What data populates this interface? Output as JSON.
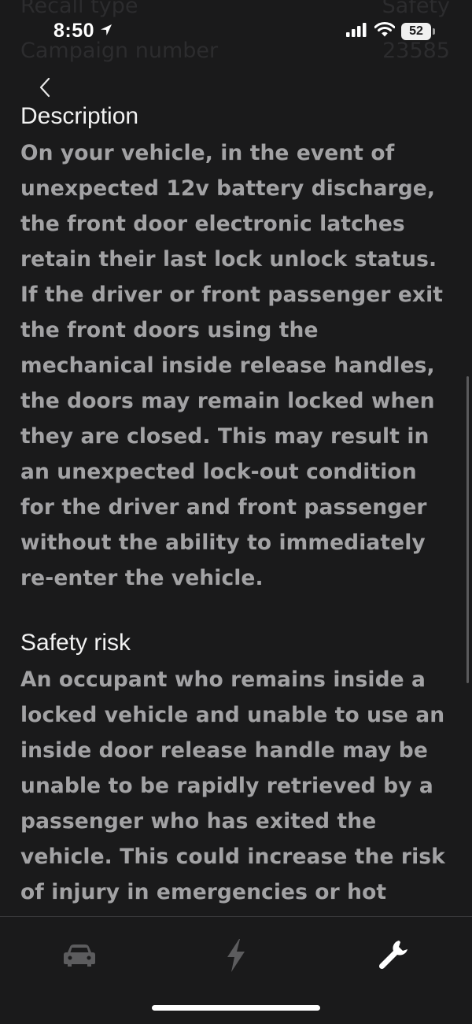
{
  "background_partial": {
    "row1": {
      "label": "Recall type",
      "value": "Safety"
    },
    "row2": {
      "label": "Campaign number",
      "value": "23585"
    }
  },
  "status_bar": {
    "time": "8:50",
    "battery": "52"
  },
  "sections": [
    {
      "title": "Description",
      "body": "On your vehicle, in the event of unexpected 12v battery discharge, the front door electronic latches retain their last lock unlock status. If the driver or front passenger exit the front doors using the mechanical inside release handles, the doors may remain locked when they are closed. This may result in an unexpected lock-out condition for the driver and front passenger without the ability to immediately re-enter the vehicle."
    },
    {
      "title": "Safety risk",
      "body": "An occupant who remains inside a locked vehicle and unable to use an inside door release handle may be unable to be rapidly retrieved by a passenger who has exited the vehicle. This could increase the risk of injury in emergencies or hot"
    }
  ],
  "tab_bar": {
    "tabs": [
      {
        "icon": "car-icon",
        "active": false
      },
      {
        "icon": "bolt-icon",
        "active": false
      },
      {
        "icon": "wrench-icon",
        "active": true
      }
    ]
  },
  "colors": {
    "background": "#1a1a1b",
    "heading": "#f2f2f2",
    "body_text": "#a2a2a4",
    "inactive_icon": "#5c5c5e",
    "active_icon": "#ffffff"
  }
}
